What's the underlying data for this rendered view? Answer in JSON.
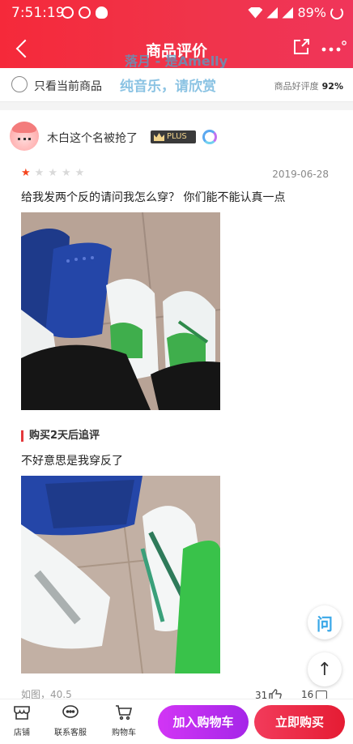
{
  "status_bar": {
    "time": "7:51:19",
    "battery": "89%"
  },
  "nav": {
    "title": "商品评价"
  },
  "watermark": {
    "line1": "落月 - 是Amelly",
    "line2": "纯音乐，请欣赏"
  },
  "filter": {
    "only_current_label": "只看当前商品",
    "rating_label": "商品好评度",
    "rating_value": "92%"
  },
  "review": {
    "username": "木白这个名被抢了",
    "badge": "PLUS",
    "stars": 1,
    "stars_max": 5,
    "date": "2019-06-28",
    "content": "给我发两个反的请问我怎么穿？ 你们能不能认真一点",
    "followup_title": "购买2天后追评",
    "followup_content": "不好意思是我穿反了",
    "meta": "如图，40.5",
    "likes": "31",
    "replies": "16"
  },
  "floating": {
    "ask_glyph": "问",
    "top_glyph": "↑"
  },
  "bottom_bar": {
    "tabs": [
      {
        "label": "店铺",
        "icon": "store-icon"
      },
      {
        "label": "联系客服",
        "icon": "customer-service-icon"
      },
      {
        "label": "购物车",
        "icon": "cart-icon"
      }
    ],
    "add_to_cart": "加入购物车",
    "buy_now": "立即购买"
  },
  "colors": {
    "header": "#f5293a",
    "cart_btn": "#c02ff0",
    "buy_btn": "#e82840",
    "star_on": "#f5461e"
  }
}
